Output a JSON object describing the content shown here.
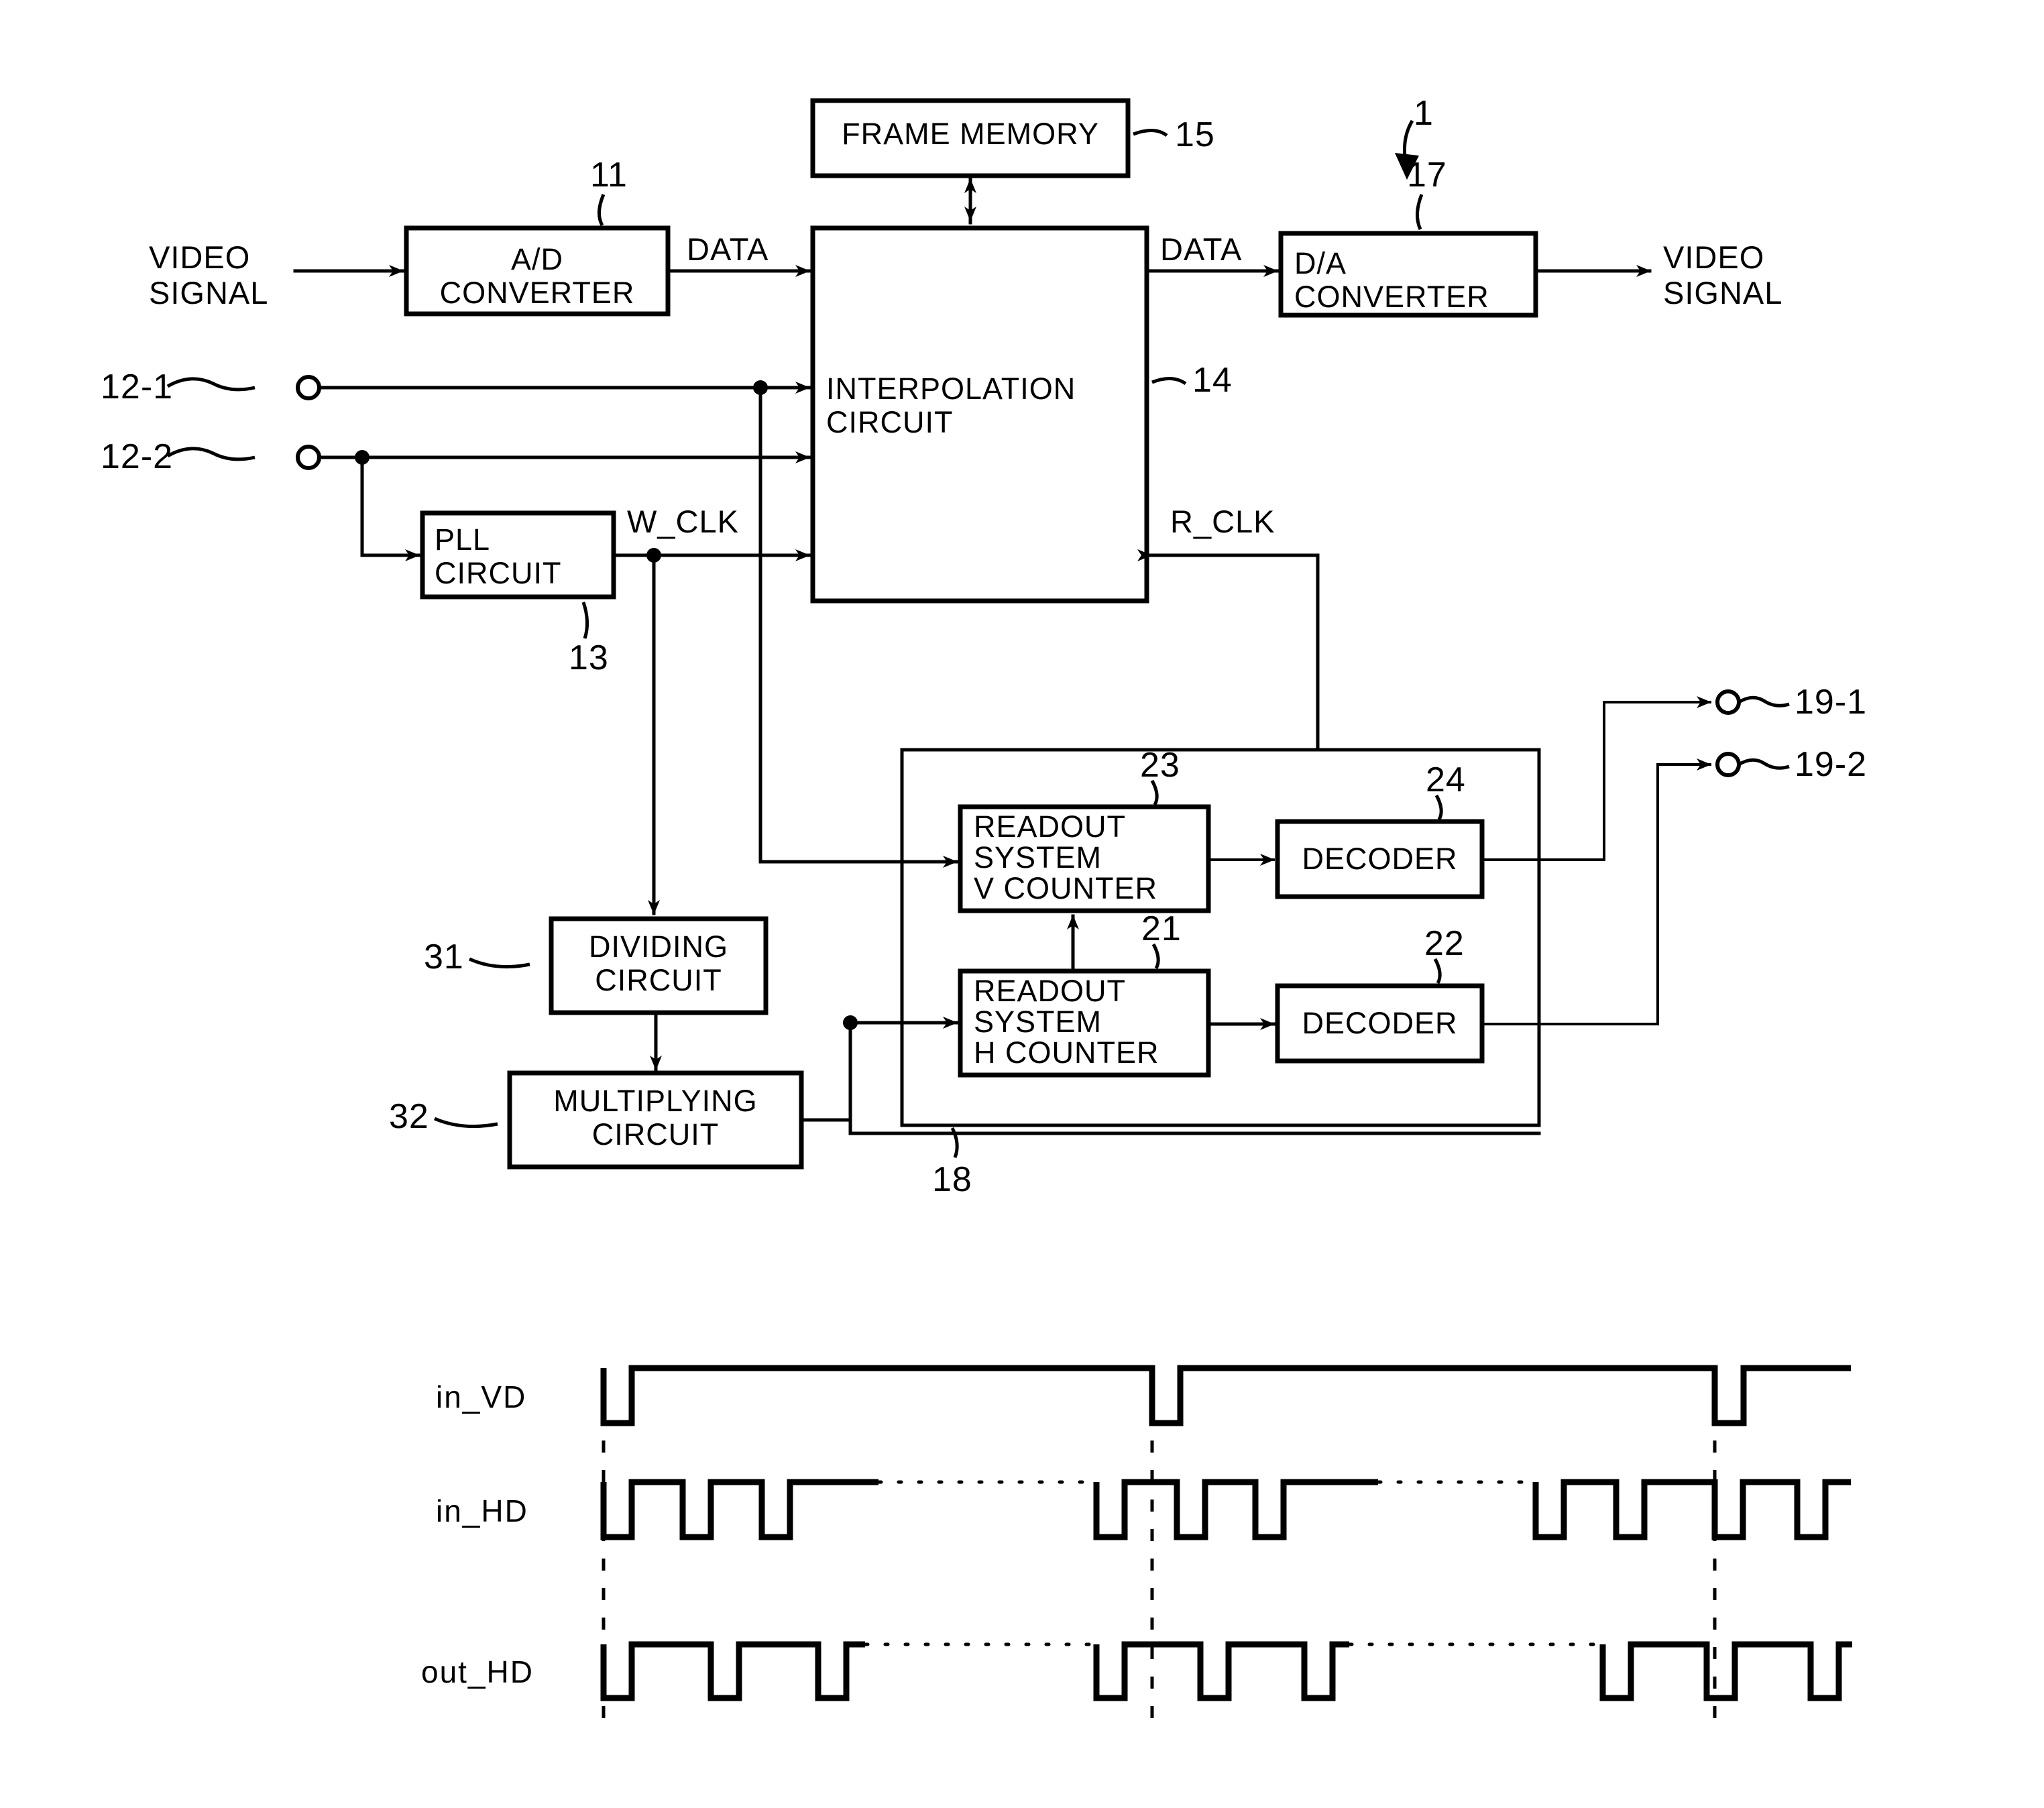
{
  "figure": {
    "type": "patent-block-diagram",
    "system_ref": "1"
  },
  "blocks": [
    {
      "id": "ad",
      "label": "A/D\nCONVERTER",
      "ref": "11"
    },
    {
      "id": "fm",
      "label": "FRAME MEMORY",
      "ref": "15"
    },
    {
      "id": "ip",
      "label": "INTERPOLATION\nCIRCUIT",
      "ref": "14"
    },
    {
      "id": "da",
      "label": "D/A\nCONVERTER",
      "ref": "17"
    },
    {
      "id": "pll",
      "label": "PLL\nCIRCUIT",
      "ref": "13"
    },
    {
      "id": "div",
      "label": "DIVIDING\nCIRCUIT",
      "ref": "31"
    },
    {
      "id": "mul",
      "label": "MULTIPLYING\nCIRCUIT",
      "ref": "32"
    },
    {
      "id": "vcnt",
      "label": "READOUT\nSYSTEM\nV COUNTER",
      "ref": "23"
    },
    {
      "id": "hcnt",
      "label": "READOUT\nSYSTEM\nH COUNTER",
      "ref": "21"
    },
    {
      "id": "dec24",
      "label": "DECODER",
      "ref": "24"
    },
    {
      "id": "dec22",
      "label": "DECODER",
      "ref": "22"
    },
    {
      "id": "group",
      "label": "",
      "ref": "18"
    }
  ],
  "signal_labels": {
    "video_in": "VIDEO\nSIGNAL",
    "video_out": "VIDEO\nSIGNAL",
    "data_in": "DATA",
    "data_out": "DATA",
    "w_clk": "W_CLK",
    "r_clk": "R_CLK"
  },
  "terminals": [
    {
      "id": "in1",
      "label": "12-1"
    },
    {
      "id": "in2",
      "label": "12-2"
    },
    {
      "id": "out1",
      "label": "19-1"
    },
    {
      "id": "out2",
      "label": "19-2"
    }
  ],
  "refs": {
    "system": "1",
    "ad_converter": "11",
    "pll_circuit": "13",
    "interpolation_circuit": "14",
    "frame_memory": "15",
    "da_converter": "17",
    "readout_block": "18",
    "h_counter": "21",
    "decoder_h": "22",
    "v_counter": "23",
    "decoder_v": "24",
    "dividing_circuit": "31",
    "multiplying_circuit": "32"
  },
  "timing": {
    "rows": [
      {
        "name": "in_VD",
        "label": "in_VD"
      },
      {
        "name": "in_HD",
        "label": "in_HD"
      },
      {
        "name": "out_HD",
        "label": "out_HD"
      }
    ]
  },
  "chart_data": {
    "type": "line",
    "title": "",
    "xlabel": "",
    "ylabel": "",
    "series": [
      {
        "name": "in_VD",
        "description": "Vertical sync: active-low narrow pulses, high between",
        "pulse_starts": [
          900,
          1720,
          2560
        ],
        "pulse_width": 42,
        "level_high": 1,
        "level_low": 0
      },
      {
        "name": "in_HD",
        "description": "Horizontal sync input: groups of low-going pulses separated by dotted continuation",
        "pulse_starts": [
          900,
          1018,
          1136,
          1635,
          1755,
          1872,
          1990,
          2290,
          2410,
          2560,
          2680
        ],
        "pulse_width": 42,
        "level_high": 1,
        "level_low": 0
      },
      {
        "name": "out_HD",
        "description": "Horizontal sync output: fewer, wider-spaced low-going pulses",
        "pulse_starts": [
          900,
          1060,
          1220,
          1635,
          1790,
          1945,
          2390,
          2545,
          2700
        ],
        "pulse_width": 42,
        "level_high": 1,
        "level_low": 0
      }
    ],
    "alignment_markers_x": [
      900,
      1720,
      2560
    ],
    "grid": false,
    "legend": "left-row-labels"
  }
}
